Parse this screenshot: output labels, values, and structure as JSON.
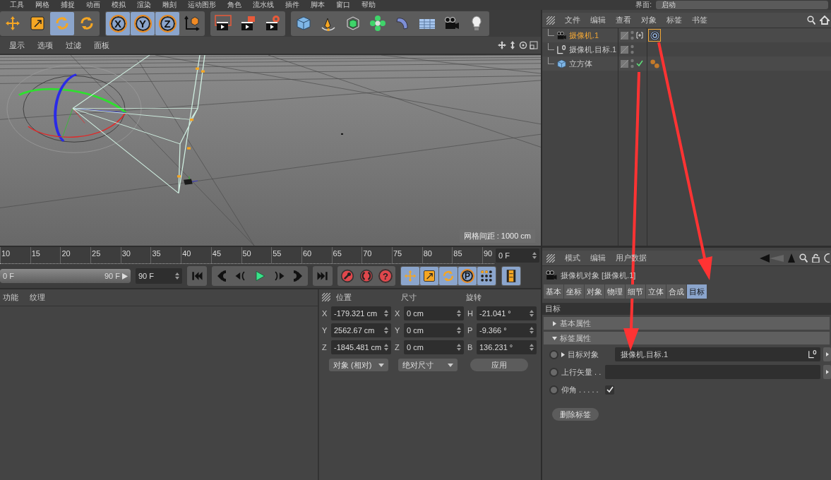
{
  "menu_bar": {
    "items": [
      "工具",
      "网格",
      "捕捉",
      "动画",
      "模拟",
      "渲染",
      "雕刻",
      "运动图形",
      "角色",
      "流水线",
      "插件",
      "脚本",
      "窗口",
      "帮助"
    ],
    "layout_label": "界面:",
    "layout_value": "启动"
  },
  "toolbar": [
    [
      {
        "kind": "move",
        "selected": false
      },
      {
        "kind": "scale",
        "selected": false
      },
      {
        "kind": "rotate",
        "selected": true
      },
      {
        "kind": "recent",
        "selected": false
      }
    ],
    [
      {
        "kind": "axis",
        "label": "X",
        "selected": true
      },
      {
        "kind": "axis",
        "label": "Y",
        "selected": true
      },
      {
        "kind": "axis",
        "label": "Z",
        "selected": true
      },
      {
        "kind": "coords",
        "selected": false
      }
    ],
    [
      {
        "kind": "renderview",
        "selected": false
      },
      {
        "kind": "render",
        "selected": false
      },
      {
        "kind": "rendersettings",
        "selected": false
      }
    ],
    [
      {
        "kind": "cube",
        "selected": false
      },
      {
        "kind": "pen",
        "selected": false
      },
      {
        "kind": "subdivide",
        "selected": false
      },
      {
        "kind": "cloner",
        "selected": false
      },
      {
        "kind": "deformer",
        "selected": false
      },
      {
        "kind": "floor",
        "selected": false
      },
      {
        "kind": "camera",
        "selected": false
      },
      {
        "kind": "light",
        "selected": false
      }
    ]
  ],
  "viewport": {
    "menu": [
      "显示",
      "选项",
      "过滤",
      "面板"
    ],
    "grid_label": "网格间距 : 1000 cm"
  },
  "timeline": {
    "ticks": [
      "10",
      "15",
      "20",
      "25",
      "30",
      "35",
      "40",
      "45",
      "50",
      "55",
      "60",
      "65",
      "70",
      "75",
      "80",
      "85",
      "90"
    ],
    "current_frame": "0 F"
  },
  "transport": {
    "range_start": "0 F",
    "range_end": "90 F",
    "level": 1,
    "end_frame": "90 F",
    "groups": [
      [
        {
          "kind": "first",
          "selected": false
        }
      ],
      [
        {
          "kind": "prevkey",
          "selected": false
        },
        {
          "kind": "prev",
          "selected": false
        },
        {
          "kind": "play",
          "selected": false
        },
        {
          "kind": "next",
          "selected": false
        },
        {
          "kind": "nextkey",
          "selected": false
        }
      ],
      [
        {
          "kind": "last",
          "selected": false
        }
      ],
      [
        {
          "kind": "record",
          "selected": false
        },
        {
          "kind": "autokey",
          "selected": false
        },
        {
          "kind": "keyhelp",
          "label": "?",
          "selected": false
        }
      ],
      [
        {
          "kind": "move",
          "selected": true
        },
        {
          "kind": "scale",
          "selected": true
        },
        {
          "kind": "rotate",
          "selected": true
        },
        {
          "kind": "param",
          "label": "P",
          "selected": true
        },
        {
          "kind": "points",
          "selected": true
        }
      ],
      [
        {
          "kind": "film",
          "selected": true
        }
      ]
    ]
  },
  "materials": {
    "menu": [
      "功能",
      "纹理"
    ]
  },
  "coordinates": {
    "headers": [
      "位置",
      "尺寸",
      "旋转"
    ],
    "rows": [
      {
        "axis_position": "X",
        "position": "-179.321 cm",
        "axis_size": "X",
        "size": "0 cm",
        "axis_rotation": "H",
        "rotation": "-21.041 °"
      },
      {
        "axis_position": "Y",
        "position": "2562.67 cm",
        "axis_size": "Y",
        "size": "0 cm",
        "axis_rotation": "P",
        "rotation": "-9.366 °"
      },
      {
        "axis_position": "Z",
        "position": "-1845.481 cm",
        "axis_size": "Z",
        "size": "0 cm",
        "axis_rotation": "B",
        "rotation": "136.231 °"
      }
    ],
    "mode": "对象 (相对)",
    "size_mode": "绝对尺寸",
    "apply": "应用"
  },
  "object_manager": {
    "menu": [
      "文件",
      "编辑",
      "查看",
      "对象",
      "标签",
      "书签"
    ],
    "objects": [
      {
        "name": "摄像机.1",
        "kind": "camera",
        "selected": true,
        "flags": [
          {
            "kind": "bracket"
          }
        ],
        "tags": [
          {
            "kind": "target",
            "selected": true
          }
        ]
      },
      {
        "name": "摄像机.目标.1",
        "kind": "null",
        "selected": false
      },
      {
        "name": "立方体",
        "kind": "cube",
        "selected": false,
        "flags": [
          {
            "kind": "check"
          }
        ],
        "tags": [
          {
            "kind": "material",
            "selected": false
          }
        ]
      }
    ]
  },
  "attributes": {
    "menu": [
      "模式",
      "编辑",
      "用户数据"
    ],
    "title": "摄像机对象 [摄像机.1]",
    "tabs": [
      {
        "label": "基本",
        "selected": false
      },
      {
        "label": "坐标",
        "selected": false
      },
      {
        "label": "对象",
        "selected": false
      },
      {
        "label": "物理",
        "selected": false
      },
      {
        "label": "细节",
        "selected": false
      },
      {
        "label": "立体",
        "selected": false
      },
      {
        "label": "合成",
        "selected": false
      },
      {
        "label": "目标",
        "selected": true
      }
    ],
    "section": "目标",
    "groups": [
      {
        "label": "基本属性",
        "expanded": false
      },
      {
        "label": "标签属性",
        "expanded": true
      }
    ],
    "fields": [
      {
        "kind": "link",
        "label": "目标对象",
        "expandable": true,
        "value": "摄像机.目标.1"
      },
      {
        "kind": "link",
        "label": "上行矢量 . .",
        "expandable": false
      },
      {
        "kind": "checkbox",
        "label": "仰角 . . . . .",
        "checked": true
      }
    ],
    "button": "删除标签"
  }
}
